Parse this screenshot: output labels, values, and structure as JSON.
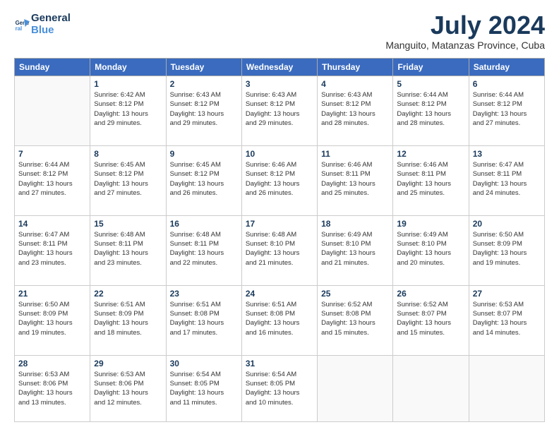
{
  "logo": {
    "line1": "General",
    "line2": "Blue"
  },
  "header": {
    "month": "July 2024",
    "location": "Manguito, Matanzas Province, Cuba"
  },
  "weekdays": [
    "Sunday",
    "Monday",
    "Tuesday",
    "Wednesday",
    "Thursday",
    "Friday",
    "Saturday"
  ],
  "weeks": [
    [
      {
        "day": "",
        "info": ""
      },
      {
        "day": "1",
        "info": "Sunrise: 6:42 AM\nSunset: 8:12 PM\nDaylight: 13 hours\nand 29 minutes."
      },
      {
        "day": "2",
        "info": "Sunrise: 6:43 AM\nSunset: 8:12 PM\nDaylight: 13 hours\nand 29 minutes."
      },
      {
        "day": "3",
        "info": "Sunrise: 6:43 AM\nSunset: 8:12 PM\nDaylight: 13 hours\nand 29 minutes."
      },
      {
        "day": "4",
        "info": "Sunrise: 6:43 AM\nSunset: 8:12 PM\nDaylight: 13 hours\nand 28 minutes."
      },
      {
        "day": "5",
        "info": "Sunrise: 6:44 AM\nSunset: 8:12 PM\nDaylight: 13 hours\nand 28 minutes."
      },
      {
        "day": "6",
        "info": "Sunrise: 6:44 AM\nSunset: 8:12 PM\nDaylight: 13 hours\nand 27 minutes."
      }
    ],
    [
      {
        "day": "7",
        "info": "Sunrise: 6:44 AM\nSunset: 8:12 PM\nDaylight: 13 hours\nand 27 minutes."
      },
      {
        "day": "8",
        "info": "Sunrise: 6:45 AM\nSunset: 8:12 PM\nDaylight: 13 hours\nand 27 minutes."
      },
      {
        "day": "9",
        "info": "Sunrise: 6:45 AM\nSunset: 8:12 PM\nDaylight: 13 hours\nand 26 minutes."
      },
      {
        "day": "10",
        "info": "Sunrise: 6:46 AM\nSunset: 8:12 PM\nDaylight: 13 hours\nand 26 minutes."
      },
      {
        "day": "11",
        "info": "Sunrise: 6:46 AM\nSunset: 8:11 PM\nDaylight: 13 hours\nand 25 minutes."
      },
      {
        "day": "12",
        "info": "Sunrise: 6:46 AM\nSunset: 8:11 PM\nDaylight: 13 hours\nand 25 minutes."
      },
      {
        "day": "13",
        "info": "Sunrise: 6:47 AM\nSunset: 8:11 PM\nDaylight: 13 hours\nand 24 minutes."
      }
    ],
    [
      {
        "day": "14",
        "info": "Sunrise: 6:47 AM\nSunset: 8:11 PM\nDaylight: 13 hours\nand 23 minutes."
      },
      {
        "day": "15",
        "info": "Sunrise: 6:48 AM\nSunset: 8:11 PM\nDaylight: 13 hours\nand 23 minutes."
      },
      {
        "day": "16",
        "info": "Sunrise: 6:48 AM\nSunset: 8:11 PM\nDaylight: 13 hours\nand 22 minutes."
      },
      {
        "day": "17",
        "info": "Sunrise: 6:48 AM\nSunset: 8:10 PM\nDaylight: 13 hours\nand 21 minutes."
      },
      {
        "day": "18",
        "info": "Sunrise: 6:49 AM\nSunset: 8:10 PM\nDaylight: 13 hours\nand 21 minutes."
      },
      {
        "day": "19",
        "info": "Sunrise: 6:49 AM\nSunset: 8:10 PM\nDaylight: 13 hours\nand 20 minutes."
      },
      {
        "day": "20",
        "info": "Sunrise: 6:50 AM\nSunset: 8:09 PM\nDaylight: 13 hours\nand 19 minutes."
      }
    ],
    [
      {
        "day": "21",
        "info": "Sunrise: 6:50 AM\nSunset: 8:09 PM\nDaylight: 13 hours\nand 19 minutes."
      },
      {
        "day": "22",
        "info": "Sunrise: 6:51 AM\nSunset: 8:09 PM\nDaylight: 13 hours\nand 18 minutes."
      },
      {
        "day": "23",
        "info": "Sunrise: 6:51 AM\nSunset: 8:08 PM\nDaylight: 13 hours\nand 17 minutes."
      },
      {
        "day": "24",
        "info": "Sunrise: 6:51 AM\nSunset: 8:08 PM\nDaylight: 13 hours\nand 16 minutes."
      },
      {
        "day": "25",
        "info": "Sunrise: 6:52 AM\nSunset: 8:08 PM\nDaylight: 13 hours\nand 15 minutes."
      },
      {
        "day": "26",
        "info": "Sunrise: 6:52 AM\nSunset: 8:07 PM\nDaylight: 13 hours\nand 15 minutes."
      },
      {
        "day": "27",
        "info": "Sunrise: 6:53 AM\nSunset: 8:07 PM\nDaylight: 13 hours\nand 14 minutes."
      }
    ],
    [
      {
        "day": "28",
        "info": "Sunrise: 6:53 AM\nSunset: 8:06 PM\nDaylight: 13 hours\nand 13 minutes."
      },
      {
        "day": "29",
        "info": "Sunrise: 6:53 AM\nSunset: 8:06 PM\nDaylight: 13 hours\nand 12 minutes."
      },
      {
        "day": "30",
        "info": "Sunrise: 6:54 AM\nSunset: 8:05 PM\nDaylight: 13 hours\nand 11 minutes."
      },
      {
        "day": "31",
        "info": "Sunrise: 6:54 AM\nSunset: 8:05 PM\nDaylight: 13 hours\nand 10 minutes."
      },
      {
        "day": "",
        "info": ""
      },
      {
        "day": "",
        "info": ""
      },
      {
        "day": "",
        "info": ""
      }
    ]
  ]
}
